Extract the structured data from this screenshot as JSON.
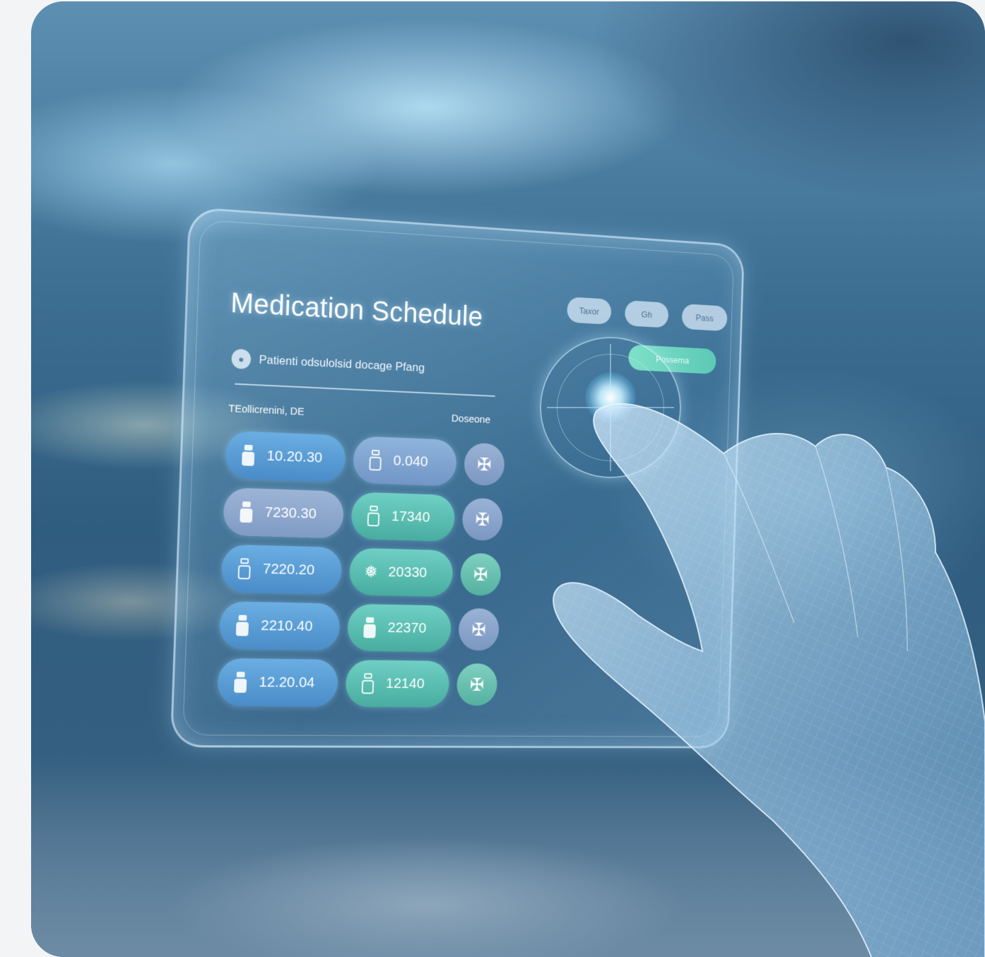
{
  "panel": {
    "title": "Medication Schedule",
    "subtitle": "Patienti odsulolsid docage Pfang",
    "column_left": "TEollicrenini, DE",
    "column_right": "Doseone",
    "top_buttons": [
      "Taxor",
      "Gh",
      "Pass"
    ],
    "accent_button": "Possema",
    "rows": [
      {
        "time": "10.20.30",
        "dose": "0.040",
        "time_style": "blue",
        "dose_style": "blue"
      },
      {
        "time": "7230.30",
        "dose": "17340",
        "time_style": "faded",
        "dose_style": "teal"
      },
      {
        "time": "7220.20",
        "dose": "20330",
        "time_style": "blue",
        "dose_style": "teal"
      },
      {
        "time": "2210.40",
        "dose": "22370",
        "time_style": "blue",
        "dose_style": "teal"
      },
      {
        "time": "12.20.04",
        "dose": "12140",
        "time_style": "blue",
        "dose_style": "teal"
      }
    ]
  },
  "icons": {
    "bottle": "medicine-bottle-icon",
    "plant": "herb-icon",
    "clover": "clover-icon"
  },
  "colors": {
    "pill_blue": "#4a8cc8",
    "pill_teal": "#47ad9f",
    "accent": "#5cc9b6"
  }
}
